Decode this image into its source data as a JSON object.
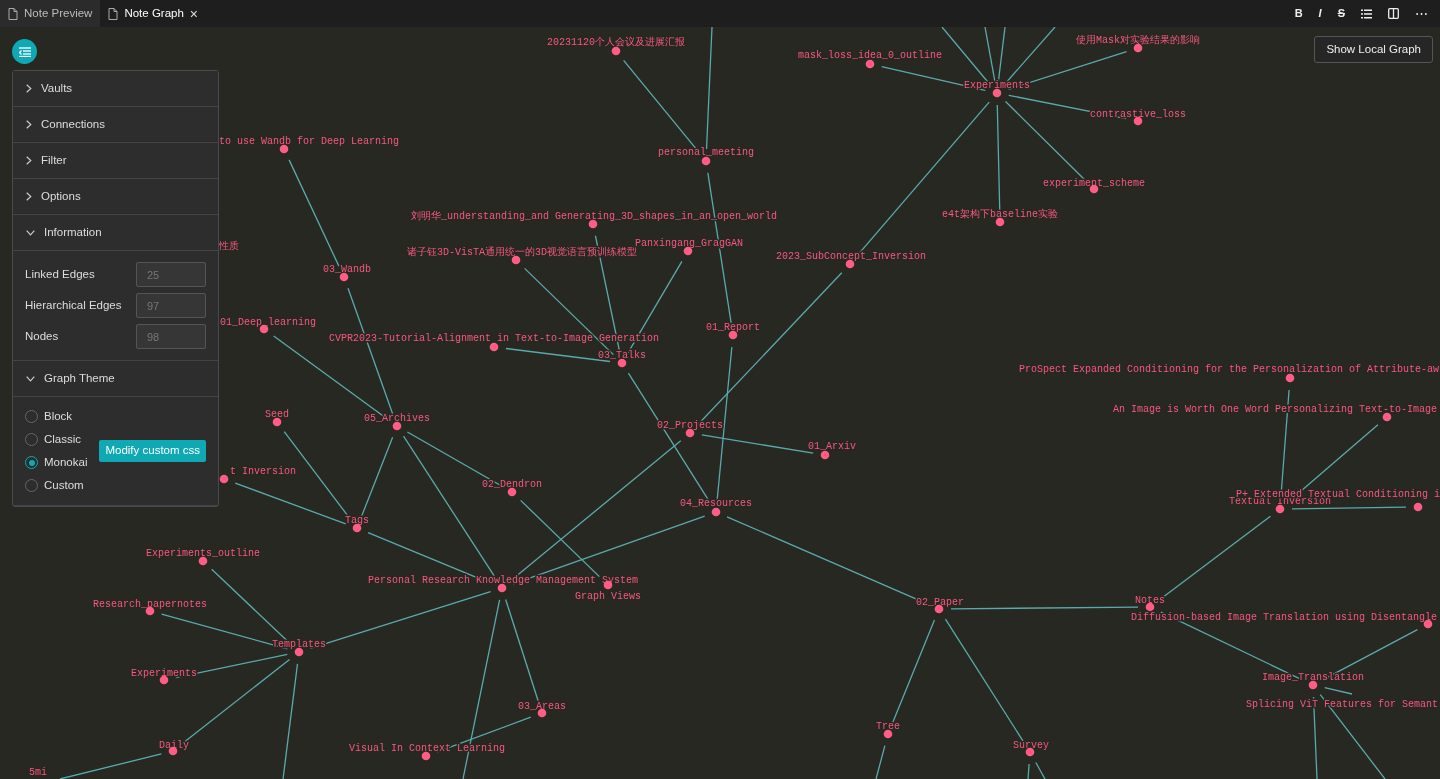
{
  "tabs": [
    {
      "label": "Note Preview",
      "selected": false
    },
    {
      "label": "Note Graph",
      "selected": true,
      "close": "×"
    }
  ],
  "toolbar": [
    {
      "kind": "bold",
      "glyph": "B"
    },
    {
      "kind": "italic",
      "glyph": "I"
    },
    {
      "kind": "strike",
      "glyph": "S"
    },
    {
      "kind": "list"
    },
    {
      "kind": "split"
    },
    {
      "kind": "more",
      "glyph": "⋯"
    }
  ],
  "panel": {
    "sections": [
      {
        "title": "Vaults",
        "expanded": false
      },
      {
        "title": "Connections",
        "expanded": false
      },
      {
        "title": "Filter",
        "expanded": false
      },
      {
        "title": "Options",
        "expanded": false
      },
      {
        "title": "Information",
        "expanded": true,
        "fields": [
          {
            "label": "Linked Edges",
            "value": "25",
            "disabled": true
          },
          {
            "label": "Hierarchical Edges",
            "value": "97",
            "disabled": true
          },
          {
            "label": "Nodes",
            "value": "98",
            "disabled": true
          }
        ]
      },
      {
        "title": "Graph Theme",
        "expanded": true,
        "themes": [
          {
            "label": "Block",
            "selected": false
          },
          {
            "label": "Classic",
            "selected": false
          },
          {
            "label": "Monokai",
            "selected": true
          },
          {
            "label": "Custom",
            "selected": false
          }
        ],
        "button": "Modify custom css"
      }
    ]
  },
  "show_local_graph": "Show Local Graph",
  "graph": {
    "nodes": [
      {
        "label": "20231120个人会议及进展汇报"
      },
      {
        "label": "personal_meeting"
      },
      {
        "label": "mask_loss_idea_0_outline"
      },
      {
        "label": "使用Mask对实验结果的影响"
      },
      {
        "label": "Experiments"
      },
      {
        "label": "contrastive_loss"
      },
      {
        "label": "experiment_scheme"
      },
      {
        "label": "e4t架构下baseline实验"
      },
      {
        "label": "to use Wandb for Deep Learning"
      },
      {
        "label": "性质"
      },
      {
        "label": "03_Wandb"
      },
      {
        "label": "刘明华_understanding_and Generating_3D_shapes_in_an_open_world"
      },
      {
        "label": "诸子钰3D-VisTA通用统一的3D视觉语言预训练模型"
      },
      {
        "label": "Panxingang_GragGAN"
      },
      {
        "label": "2023_SubConcept_Inversion"
      },
      {
        "label": "01_Deep_learning"
      },
      {
        "label": "CVPR2023-Tutorial-Alignment in Text-to-Image Generation"
      },
      {
        "label": "03_Talks"
      },
      {
        "label": "01_Report"
      },
      {
        "label": "ProSpect Expanded Conditioning for the Personalization of Attribute-aw"
      },
      {
        "label": "Seed"
      },
      {
        "label": "An Image is Worth One Word Personalizing Text-to-Image"
      },
      {
        "label": "05_Archives"
      },
      {
        "label": "02_Projects"
      },
      {
        "label": "01_Arxiv"
      },
      {
        "label": "t Inversion"
      },
      {
        "label": "02_Dendron"
      },
      {
        "label": "04_Resources"
      },
      {
        "label": "Textual Inversion"
      },
      {
        "label": "P+ Extended Textual Conditioning i"
      },
      {
        "label": "Tags"
      },
      {
        "label": "Experiments_outline"
      },
      {
        "label": "Personal Research Knowledge Management System"
      },
      {
        "label": "Graph Views"
      },
      {
        "label": "02_Paper"
      },
      {
        "label": "Notes"
      },
      {
        "label": "Research_papernotes"
      },
      {
        "label": "Diffusion-based Image Translation using Disentangle"
      },
      {
        "label": "Templates"
      },
      {
        "label": "Experiments"
      },
      {
        "label": "Image_Translation"
      },
      {
        "label": "03_Areas"
      },
      {
        "label": "Splicing ViT Features for Semant"
      },
      {
        "label": "Tree"
      },
      {
        "label": "Daily"
      },
      {
        "label": "Visual In Context Learning"
      },
      {
        "label": "Survey"
      },
      {
        "label": "5mi"
      }
    ]
  }
}
